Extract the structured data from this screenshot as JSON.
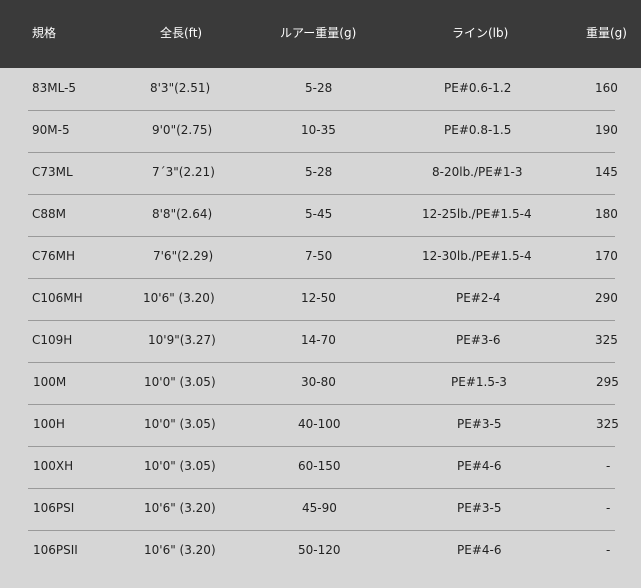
{
  "headers": [
    "規格",
    "全長(ft)",
    "ルアー重量(g)",
    "ライン(lb)",
    "重量(g)"
  ],
  "rows": [
    [
      "83ML-5",
      "8'3\"(2.51)",
      "5-28",
      "PE#0.6-1.2",
      "160"
    ],
    [
      "90M-5",
      "9'0\"(2.75)",
      "10-35",
      "PE#0.8-1.5",
      "190"
    ],
    [
      "C73ML",
      "7´3\"(2.21)",
      "5-28",
      "8-20lb./PE#1-3",
      "145"
    ],
    [
      "C88M",
      "8'8\"(2.64)",
      "5-45",
      "12-25lb./PE#1.5-4",
      "180"
    ],
    [
      "C76MH",
      "7'6\"(2.29)",
      "7-50",
      "12-30lb./PE#1.5-4",
      "170"
    ],
    [
      "C106MH",
      "10'6\" (3.20)",
      "12-50",
      "PE#2-4",
      "290"
    ],
    [
      "C109H",
      "10'9\"(3.27)",
      "14-70",
      "PE#3-6",
      "325"
    ],
    [
      "100M",
      "10'0\" (3.05)",
      "30-80",
      "PE#1.5-3",
      "295"
    ],
    [
      "100H",
      "10'0\" (3.05)",
      "40-100",
      "PE#3-5",
      "325"
    ],
    [
      "100XH",
      "10'0\" (3.05)",
      "60-150",
      "PE#4-6",
      "-"
    ],
    [
      "106PSI",
      "10'6\" (3.20)",
      "45-90",
      "PE#3-5",
      "-"
    ],
    [
      "106PSII",
      "10'6\" (3.20)",
      "50-120",
      "PE#4-6",
      "-"
    ]
  ]
}
